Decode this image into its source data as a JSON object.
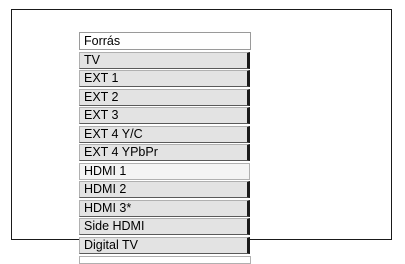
{
  "menu": {
    "header": "Forrás",
    "items": [
      {
        "label": "TV"
      },
      {
        "label": "EXT 1"
      },
      {
        "label": "EXT 2"
      },
      {
        "label": "EXT 3"
      },
      {
        "label": "EXT 4 Y/C"
      },
      {
        "label": "EXT 4 YPbPr"
      },
      {
        "label": "HDMI 1"
      },
      {
        "label": "HDMI 2"
      },
      {
        "label": "HDMI 3*"
      },
      {
        "label": "Side HDMI"
      },
      {
        "label": "Digital TV"
      }
    ],
    "selected_index": 6
  }
}
